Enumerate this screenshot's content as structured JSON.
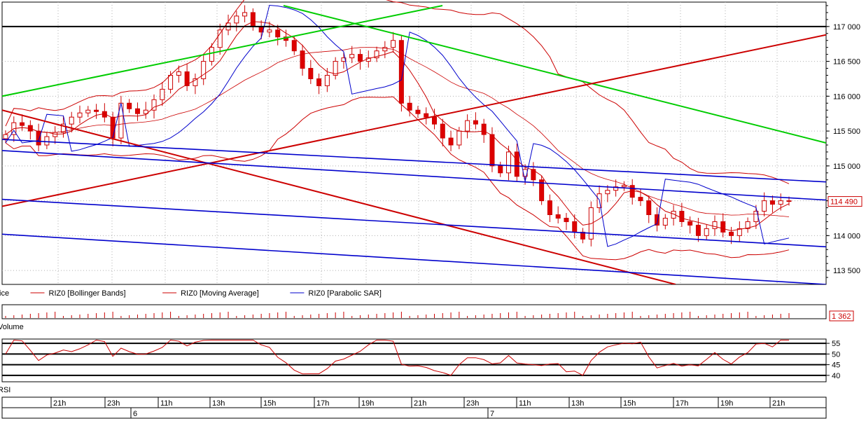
{
  "chart_data": [
    {
      "panel": "price",
      "type": "candlestick",
      "x_labels": [
        "21h",
        "23h",
        "11h",
        "13h",
        "15h",
        "17h",
        "19h",
        "21h",
        "23h",
        "11h",
        "13h",
        "15h",
        "17h",
        "19h",
        "21h"
      ],
      "day_labels": [
        {
          "label": "6",
          "at": "21h"
        },
        {
          "label": "7",
          "at": "23h"
        }
      ],
      "y_ticks": [
        "113 500",
        "114 000",
        "114 500",
        "115 000",
        "115 500",
        "116 000",
        "116 500",
        "117 000"
      ],
      "ylim": [
        113300,
        117350
      ],
      "last_value": "114 490",
      "legend": [
        {
          "label": "Price",
          "color": "#000000"
        },
        {
          "label": "RIZ0 [Bollinger Bands]",
          "color": "#cc0000"
        },
        {
          "label": "RIZ0 [Moving Average]",
          "color": "#cc0000"
        },
        {
          "label": "RIZ0 [Parabolic SAR]",
          "color": "#0000cc"
        }
      ],
      "close_series": [
        115450,
        115620,
        115580,
        115500,
        115300,
        115420,
        115480,
        115600,
        115700,
        115760,
        115800,
        115780,
        115700,
        115400,
        115900,
        115820,
        115750,
        115800,
        115950,
        116100,
        116300,
        116350,
        116150,
        116250,
        116500,
        116700,
        116950,
        117050,
        117150,
        117200,
        117000,
        116920,
        116950,
        116850,
        116800,
        116650,
        116400,
        116250,
        116150,
        116300,
        116500,
        116550,
        116600,
        116500,
        116550,
        116650,
        116700,
        116800,
        115900,
        115800,
        115750,
        115700,
        115600,
        115400,
        115300,
        115500,
        115650,
        115600,
        115450,
        115000,
        114900,
        115200,
        114850,
        114950,
        114800,
        114500,
        114300,
        114250,
        114200,
        114050,
        113950,
        114400,
        114600,
        114650,
        114700,
        114720,
        114550,
        114500,
        114300,
        114150,
        114250,
        114350,
        114200,
        114150,
        114000,
        114100,
        114200,
        114050,
        114000,
        114100,
        114200,
        114350,
        114500,
        114450,
        114500,
        114490
      ],
      "annotation_lines": [
        {
          "name": "horizontal-level",
          "color": "#000000",
          "y_value": 117000
        },
        {
          "name": "green-support",
          "color": "#00cc00",
          "points": [
            [
              "start",
              116000
            ],
            [
              "mid",
              117300
            ]
          ]
        },
        {
          "name": "green-resistance",
          "color": "#00cc00",
          "points": [
            [
              "early",
              117300
            ],
            [
              "end",
              115330
            ]
          ]
        },
        {
          "name": "red-rising",
          "color": "#cc0000",
          "points": [
            [
              "start",
              114420
            ],
            [
              "end",
              116880
            ]
          ]
        },
        {
          "name": "red-falling",
          "color": "#cc0000",
          "points": [
            [
              "start",
              115800
            ],
            [
              "mid",
              113300
            ]
          ]
        }
      ]
    },
    {
      "panel": "volume",
      "type": "bar",
      "last_value": "1 362",
      "legend": [
        {
          "label": "Volume"
        }
      ]
    },
    {
      "panel": "rsi",
      "type": "line",
      "y_ticks": [
        "40",
        "45",
        "50",
        "55"
      ],
      "ylim": [
        37,
        57
      ],
      "legend": [
        {
          "label": "RSI"
        }
      ]
    }
  ]
}
